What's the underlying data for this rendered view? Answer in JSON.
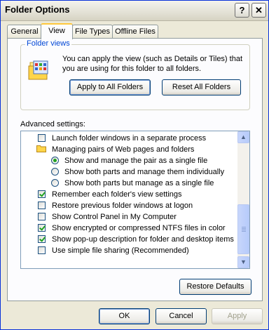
{
  "window": {
    "title": "Folder Options",
    "help_glyph": "?",
    "close_glyph": "✕"
  },
  "tabs": [
    {
      "label": "General",
      "active": false
    },
    {
      "label": "View",
      "active": true
    },
    {
      "label": "File Types",
      "active": false
    },
    {
      "label": "Offline Files",
      "active": false
    }
  ],
  "folder_views": {
    "group_label": "Folder views",
    "description": "You can apply the view (such as Details or Tiles) that you are using for this folder to all folders.",
    "apply_label": "Apply to All Folders",
    "reset_label": "Reset All Folders"
  },
  "advanced": {
    "label": "Advanced settings:",
    "items": [
      {
        "type": "checkbox",
        "checked": false,
        "indent": 0,
        "label": "Launch folder windows in a separate process"
      },
      {
        "type": "folder",
        "indent": 0,
        "label": "Managing pairs of Web pages and folders"
      },
      {
        "type": "radio",
        "checked": true,
        "indent": 1,
        "label": "Show and manage the pair as a single file"
      },
      {
        "type": "radio",
        "checked": false,
        "indent": 1,
        "label": "Show both parts and manage them individually"
      },
      {
        "type": "radio",
        "checked": false,
        "indent": 1,
        "label": "Show both parts but manage as a single file"
      },
      {
        "type": "checkbox",
        "checked": true,
        "indent": 0,
        "label": "Remember each folder's view settings"
      },
      {
        "type": "checkbox",
        "checked": false,
        "indent": 0,
        "label": "Restore previous folder windows at logon"
      },
      {
        "type": "checkbox",
        "checked": false,
        "indent": 0,
        "label": "Show Control Panel in My Computer"
      },
      {
        "type": "checkbox",
        "checked": true,
        "indent": 0,
        "label": "Show encrypted or compressed NTFS files in color"
      },
      {
        "type": "checkbox",
        "checked": true,
        "indent": 0,
        "label": "Show pop-up description for folder and desktop items"
      },
      {
        "type": "checkbox",
        "checked": false,
        "indent": 0,
        "label": "Use simple file sharing (Recommended)"
      }
    ],
    "restore_label": "Restore Defaults"
  },
  "footer": {
    "ok_label": "OK",
    "cancel_label": "Cancel",
    "apply_label": "Apply"
  },
  "icons": {
    "folder_views": "folder-views-icon",
    "folder": "folder-icon",
    "scroll_up": "scroll-up-arrow-icon",
    "scroll_down": "scroll-down-arrow-icon"
  },
  "colors": {
    "titlebar_text": "#000000",
    "group_label": "#0046d5",
    "check_mark": "#21a121"
  }
}
